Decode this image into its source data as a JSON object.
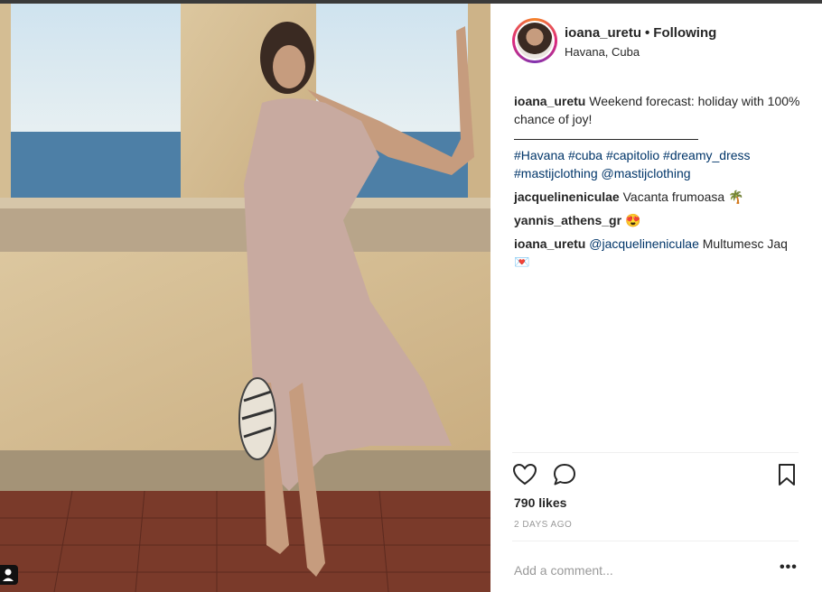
{
  "post": {
    "username": "ioana_uretu",
    "separator": "•",
    "follow_status": "Following",
    "location": "Havana, Cuba",
    "caption": {
      "username": "ioana_uretu",
      "text": "Weekend forecast: holiday with 100% chance of joy!",
      "hashtags": [
        "#Havana",
        "#cuba",
        "#capitolio",
        "#dreamy_dress",
        "#mastijclothing"
      ],
      "mention": "@mastijclothing"
    },
    "comments": [
      {
        "username": "jacquelineniculae",
        "text": "Vacanta frumoasa",
        "emoji": "🌴"
      },
      {
        "username": "yannis_athens_gr",
        "text": "",
        "emoji": "😍"
      },
      {
        "username": "ioana_uretu",
        "mention": "@jacquelineniculae",
        "text": "Multumesc Jaq",
        "emoji": "💌"
      }
    ],
    "likes": "790 likes",
    "date": "2 DAYS AGO",
    "add_comment_placeholder": "Add a comment...",
    "more_label": "•••"
  },
  "icons": {
    "like": "heart-icon",
    "comment": "comment-icon",
    "save": "bookmark-icon",
    "tag": "user-tag-icon"
  },
  "colors": {
    "link": "#003569",
    "text": "#262626",
    "muted": "#999999"
  }
}
